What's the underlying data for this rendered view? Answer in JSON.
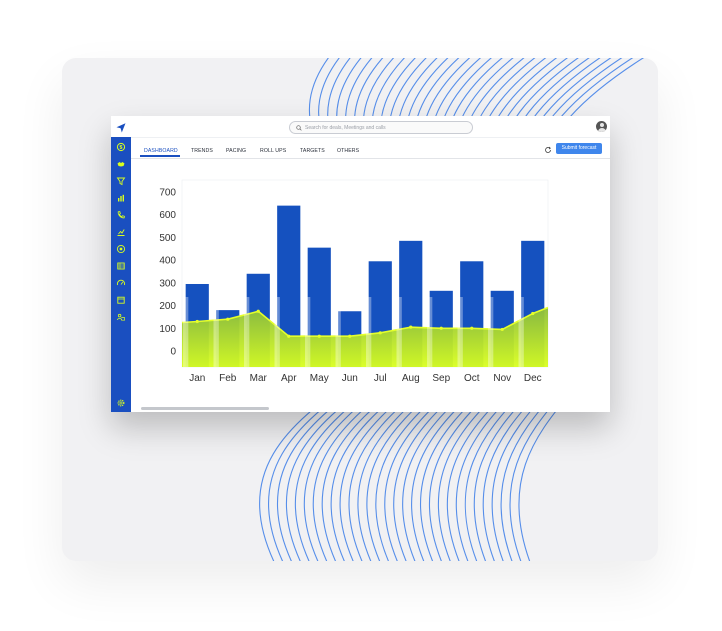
{
  "search": {
    "placeholder": "Search for deals, Meetings and calls"
  },
  "tabs": [
    {
      "label": "DASHBOARD",
      "active": true
    },
    {
      "label": "TRENDS",
      "active": false
    },
    {
      "label": "PACING",
      "active": false
    },
    {
      "label": "ROLL UPS",
      "active": false
    },
    {
      "label": "TARGETS",
      "active": false
    },
    {
      "label": "OTHERS",
      "active": false
    }
  ],
  "toolbar": {
    "submit_label": "Submit forecast",
    "refresh_icon": "refresh-icon"
  },
  "sidebar": {
    "logo_icon": "navigation-arrow-icon",
    "items": [
      {
        "icon": "dollar-icon"
      },
      {
        "icon": "handshake-icon"
      },
      {
        "icon": "funnel-icon"
      },
      {
        "icon": "bar-chart-icon"
      },
      {
        "icon": "phone-icon"
      },
      {
        "icon": "growth-chart-icon"
      },
      {
        "icon": "target-icon"
      },
      {
        "icon": "table-icon"
      },
      {
        "icon": "gauge-icon"
      },
      {
        "icon": "calendar-icon"
      },
      {
        "icon": "team-icon"
      }
    ],
    "settings_icon": "settings-icon"
  },
  "colors": {
    "accent": "#1a4fc0",
    "bar": "#1551bf",
    "area_top": "#8fbf3a",
    "area_bottom": "#d9ff1e",
    "button": "#3f86ec",
    "wave_lines": "#3b7ce8"
  },
  "chart_data": {
    "type": "bar",
    "categories": [
      "Jan",
      "Feb",
      "Mar",
      "Apr",
      "May",
      "Jun",
      "Jul",
      "Aug",
      "Sep",
      "Oct",
      "Nov",
      "Dec"
    ],
    "series": [
      {
        "type": "bar",
        "values": [
          295,
          180,
          340,
          640,
          455,
          175,
          395,
          485,
          265,
          395,
          265,
          485
        ]
      },
      {
        "type": "area",
        "values": [
          130,
          140,
          175,
          65,
          65,
          65,
          80,
          105,
          100,
          100,
          95,
          165
        ]
      }
    ],
    "ylim": [
      0,
      700
    ],
    "yticks": [
      0,
      100,
      200,
      300,
      400,
      500,
      600,
      700
    ],
    "grid": false
  }
}
